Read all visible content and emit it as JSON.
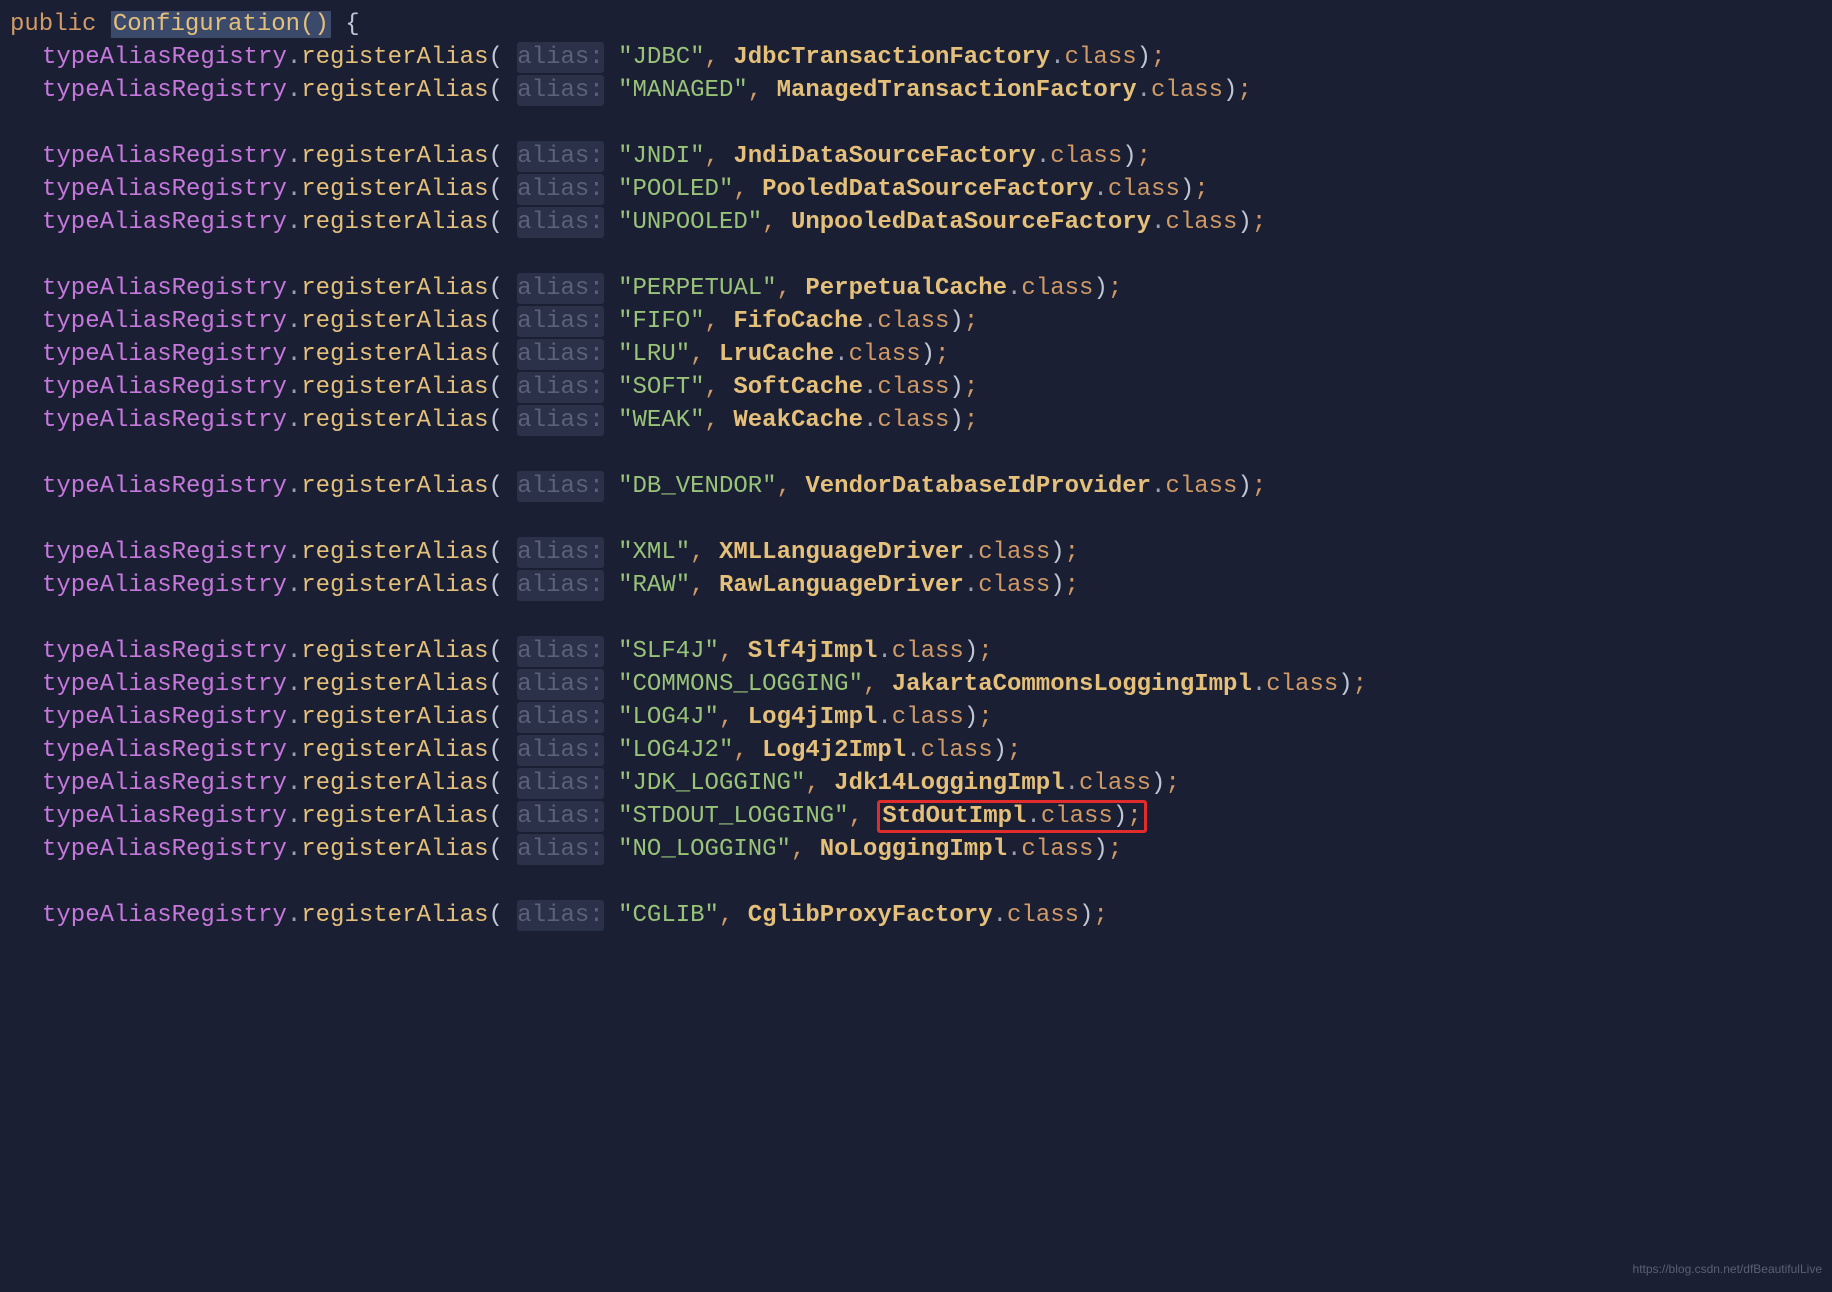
{
  "signature": {
    "modifier": "public",
    "name": "Configuration",
    "parens": "()",
    "brace": "{"
  },
  "hintLabel": "alias:",
  "registry": "typeAliasRegistry",
  "method": "registerAlias",
  "classKw": "class",
  "lines": [
    {
      "type": "sig"
    },
    {
      "type": "call",
      "alias": "\"JDBC\"",
      "cls": "JdbcTransactionFactory"
    },
    {
      "type": "call",
      "alias": "\"MANAGED\"",
      "cls": "ManagedTransactionFactory"
    },
    {
      "type": "blank"
    },
    {
      "type": "call",
      "alias": "\"JNDI\"",
      "cls": "JndiDataSourceFactory"
    },
    {
      "type": "call",
      "alias": "\"POOLED\"",
      "cls": "PooledDataSourceFactory"
    },
    {
      "type": "call",
      "alias": "\"UNPOOLED\"",
      "cls": "UnpooledDataSourceFactory"
    },
    {
      "type": "blank"
    },
    {
      "type": "call",
      "alias": "\"PERPETUAL\"",
      "cls": "PerpetualCache"
    },
    {
      "type": "call",
      "alias": "\"FIFO\"",
      "cls": "FifoCache"
    },
    {
      "type": "call",
      "alias": "\"LRU\"",
      "cls": "LruCache"
    },
    {
      "type": "call",
      "alias": "\"SOFT\"",
      "cls": "SoftCache"
    },
    {
      "type": "call",
      "alias": "\"WEAK\"",
      "cls": "WeakCache"
    },
    {
      "type": "blank"
    },
    {
      "type": "call",
      "alias": "\"DB_VENDOR\"",
      "cls": "VendorDatabaseIdProvider"
    },
    {
      "type": "blank"
    },
    {
      "type": "call",
      "alias": "\"XML\"",
      "cls": "XMLLanguageDriver"
    },
    {
      "type": "call",
      "alias": "\"RAW\"",
      "cls": "RawLanguageDriver"
    },
    {
      "type": "blank"
    },
    {
      "type": "call",
      "alias": "\"SLF4J\"",
      "cls": "Slf4jImpl"
    },
    {
      "type": "call",
      "alias": "\"COMMONS_LOGGING\"",
      "cls": "JakartaCommonsLoggingImpl"
    },
    {
      "type": "call",
      "alias": "\"LOG4J\"",
      "cls": "Log4jImpl"
    },
    {
      "type": "call",
      "alias": "\"LOG4J2\"",
      "cls": "Log4j2Impl"
    },
    {
      "type": "call",
      "alias": "\"JDK_LOGGING\"",
      "cls": "Jdk14LoggingImpl"
    },
    {
      "type": "call",
      "alias": "\"STDOUT_LOGGING\"",
      "cls": "StdOutImpl",
      "highlight": true
    },
    {
      "type": "call",
      "alias": "\"NO_LOGGING\"",
      "cls": "NoLoggingImpl"
    },
    {
      "type": "blank"
    },
    {
      "type": "call",
      "alias": "\"CGLIB\"",
      "cls": "CglibProxyFactory"
    }
  ],
  "watermark": "https://blog.csdn.net/dfBeautifulLive"
}
